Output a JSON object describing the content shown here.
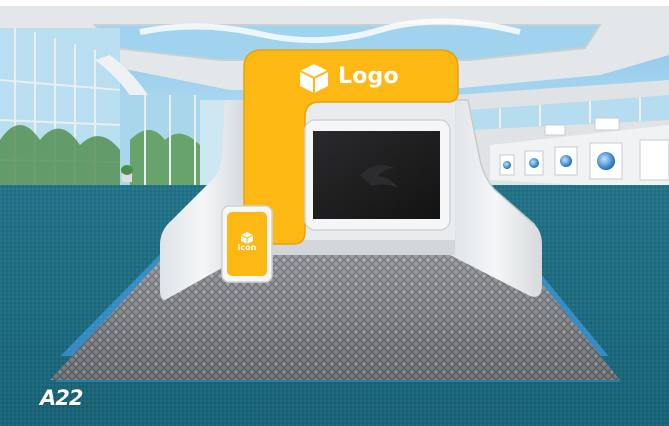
{
  "booth": {
    "logo_text": "Logo",
    "icon_text": "icon",
    "booth_number": "A22",
    "brand_color": "#FDB813",
    "logo_icon": "cube-icon",
    "icon_stand_icon": "cube-icon"
  },
  "hall": {
    "floor_color": "#1F6B80",
    "wall_color": "#E8ECEE",
    "sky_color": "#9FD3EE"
  }
}
